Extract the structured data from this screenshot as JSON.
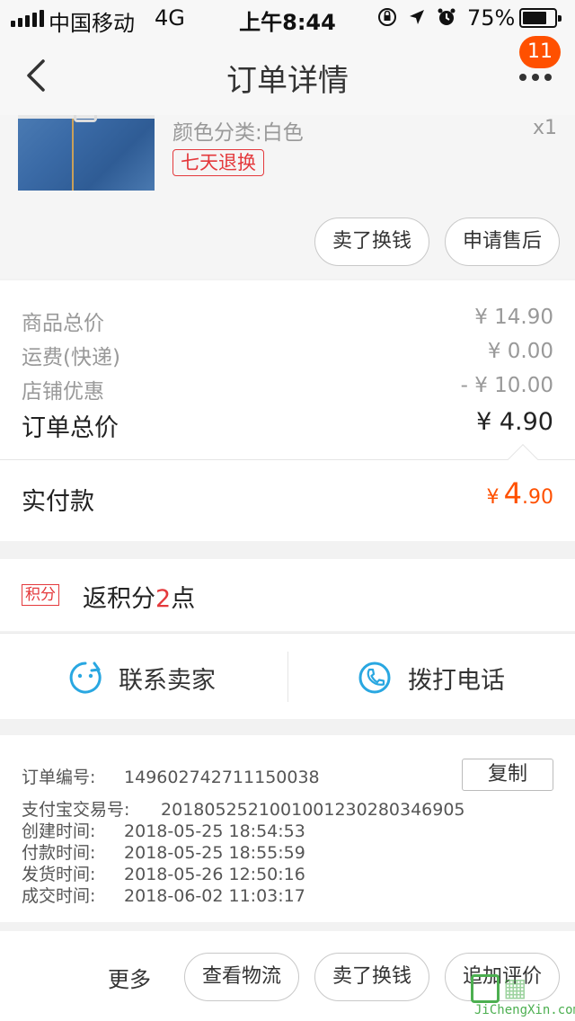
{
  "status_bar": {
    "carrier": "中国移动",
    "network": "4G",
    "time": "上午8:44",
    "battery": "75%",
    "battery_level": 0.75
  },
  "nav": {
    "title": "订单详情",
    "badge_count": "11"
  },
  "product": {
    "sku": "颜色分类:白色",
    "quantity": "x1",
    "service_tag": "七天退换",
    "actions": [
      "卖了换钱",
      "申请售后"
    ]
  },
  "prices": {
    "rows": [
      {
        "label": "商品总价",
        "value": "¥ 14.90"
      },
      {
        "label": "运费(快递)",
        "value": "¥ 0.00"
      },
      {
        "label": "店铺优惠",
        "value": "- ¥ 10.00"
      }
    ],
    "total_label": "订单总价",
    "total_value": "¥ 4.90",
    "paid_label": "实付款",
    "paid_symbol": "¥",
    "paid_int": "4",
    "paid_dec": ".90"
  },
  "points": {
    "tag": "积分",
    "prefix": "返积分",
    "amount": "2",
    "suffix": "点"
  },
  "contact": {
    "seller_label": "联系卖家",
    "phone_label": "拨打电话"
  },
  "order_info": {
    "order_no_label": "订单编号:",
    "order_no": "149602742711150038",
    "copy_label": "复制",
    "alipay_label": "支付宝交易号:",
    "alipay_no": "2018052521001001230280346905",
    "created_label": "创建时间:",
    "created": "2018-05-25 18:54:53",
    "paid_time_label": "付款时间:",
    "paid_time": "2018-05-25 18:55:59",
    "shipped_label": "发货时间:",
    "shipped": "2018-05-26 12:50:16",
    "completed_label": "成交时间:",
    "completed": "2018-06-02 11:03:17"
  },
  "bottom_bar": {
    "more_label": "更多",
    "actions": [
      "查看物流",
      "卖了换钱",
      "追加评价"
    ]
  },
  "watermark": {
    "text": "JiChengXin.com"
  },
  "colors": {
    "accent": "#ff5000",
    "tag_red": "#e4393c",
    "icon_blue": "#29a7e1"
  }
}
